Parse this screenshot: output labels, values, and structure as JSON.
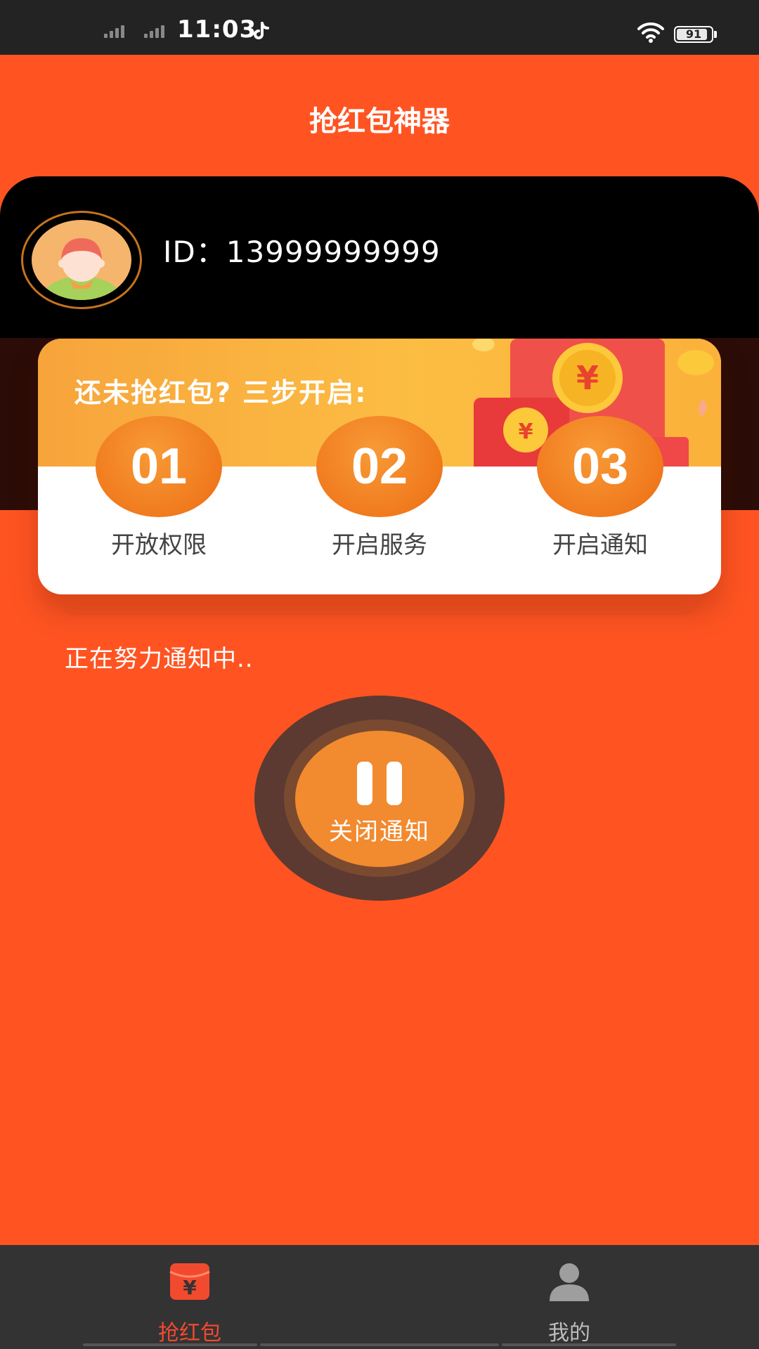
{
  "status_bar": {
    "time": "11:03",
    "battery": "91"
  },
  "app": {
    "title": "抢红包神器"
  },
  "profile": {
    "id_text": "ID：13999999999"
  },
  "steps": {
    "headline": "还未抢红包?  三步开启:",
    "items": [
      {
        "number": "01",
        "label": "开放权限"
      },
      {
        "number": "02",
        "label": "开启服务"
      },
      {
        "number": "03",
        "label": "开启通知"
      }
    ]
  },
  "notify": {
    "status_text": "正在努力通知中..",
    "toggle_label": "关闭通知"
  },
  "tabs": [
    {
      "label": "抢红包",
      "icon": "red-envelope-icon",
      "active": true
    },
    {
      "label": "我的",
      "icon": "user-icon",
      "active": false
    }
  ],
  "colors": {
    "background": "#ff5422",
    "accent": "#f24a2e",
    "button": "#f28a2f",
    "tab_bar": "#343334"
  }
}
